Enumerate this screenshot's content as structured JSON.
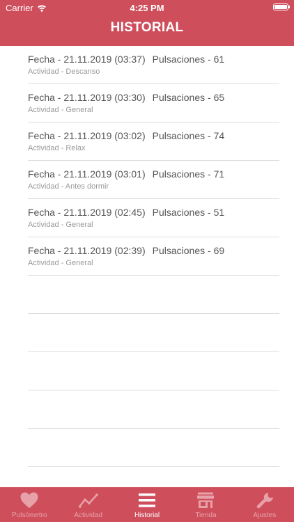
{
  "status_bar": {
    "carrier": "Carrier",
    "time": "4:25 PM"
  },
  "header": {
    "title": "HISTORIAL"
  },
  "records": [
    {
      "fecha": "Fecha - 21.11.2019 (03:37)",
      "pulsaciones": "Pulsaciones - 61",
      "actividad": "Actividad - Descanso"
    },
    {
      "fecha": "Fecha - 21.11.2019 (03:30)",
      "pulsaciones": "Pulsaciones - 65",
      "actividad": "Actividad - General"
    },
    {
      "fecha": "Fecha - 21.11.2019 (03:02)",
      "pulsaciones": "Pulsaciones - 74",
      "actividad": "Actividad - Relax"
    },
    {
      "fecha": "Fecha - 21.11.2019 (03:01)",
      "pulsaciones": "Pulsaciones - 71",
      "actividad": "Actividad - Antes dormir"
    },
    {
      "fecha": "Fecha - 21.11.2019 (02:45)",
      "pulsaciones": "Pulsaciones - 51",
      "actividad": "Actividad - General"
    },
    {
      "fecha": "Fecha - 21.11.2019 (02:39)",
      "pulsaciones": "Pulsaciones - 69",
      "actividad": "Actividad - General"
    }
  ],
  "tabs": [
    {
      "label": "Pulsómetro",
      "icon": "heart-icon"
    },
    {
      "label": "Actividad",
      "icon": "activity-chart-icon"
    },
    {
      "label": "Historial",
      "icon": "list-icon"
    },
    {
      "label": "Tienda",
      "icon": "store-icon"
    },
    {
      "label": "Ajustes",
      "icon": "wrench-icon"
    }
  ],
  "colors": {
    "accent": "#cf4e5c",
    "tab_inactive": "#e7a2a9",
    "tab_active": "#ffffff"
  }
}
